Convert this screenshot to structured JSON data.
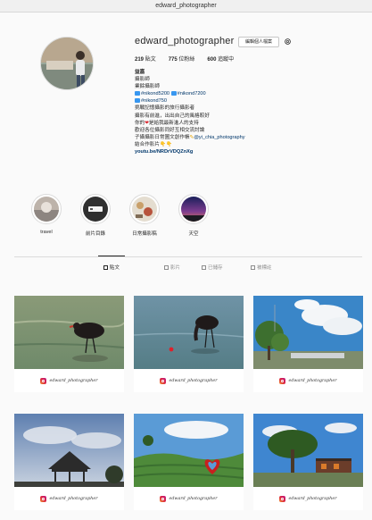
{
  "window": {
    "title": "edward_photographer"
  },
  "profile": {
    "username": "edward_photographer",
    "edit_label": "編輯個人檔案",
    "stats": {
      "posts": "219",
      "posts_label": "貼文",
      "followers": "775",
      "followers_label": "位粉絲",
      "following": "600",
      "following_label": "追蹤中"
    },
    "bio": {
      "name": "益嘉",
      "line1": "攝影師",
      "line2": "業餘攝影師",
      "tag1": "#nikond5200",
      "tag2": "#nikond7200",
      "tag3": "#nikond750",
      "line4": "挑戰記憶攝影的旅行攝影者",
      "line5": "攝影有前進，出出自己的風格較好",
      "line6a": "你的",
      "line6b": "是給我最新進人的支持",
      "line7": "歡迎各位攝影同好互相交流討論",
      "line8a": "子攝攝影日常圖文創作帳",
      "line8b": "@yi_chia_photography",
      "line9": "結合作影片",
      "url": "youtu.be/NRDrVDQZnXg"
    }
  },
  "highlights": [
    {
      "label": "travel"
    },
    {
      "label": "前片目錄"
    },
    {
      "label": "日常攝影稿"
    },
    {
      "label": "天空"
    }
  ],
  "tabs": [
    {
      "label": "貼文"
    },
    {
      "label": "影片"
    },
    {
      "label": "已儲存"
    },
    {
      "label": "被標註"
    }
  ],
  "posts": [
    {
      "watermark": "edward_photographer",
      "subject": "black bird standing in water"
    },
    {
      "watermark": "edward_photographer",
      "subject": "black bird drinking from water"
    },
    {
      "watermark": "edward_photographer",
      "subject": "tree under blue sky with white clouds"
    },
    {
      "watermark": "edward_photographer",
      "subject": "pavilion silhouette under cloudy sky"
    },
    {
      "watermark": "edward_photographer",
      "subject": "heart sculpture at tea plantation"
    },
    {
      "watermark": "edward_photographer",
      "subject": "large tree beside building on hill"
    }
  ],
  "colors": {
    "link": "#00376b",
    "ig_gradient": "#dc2743",
    "heart": "#d9262e"
  }
}
